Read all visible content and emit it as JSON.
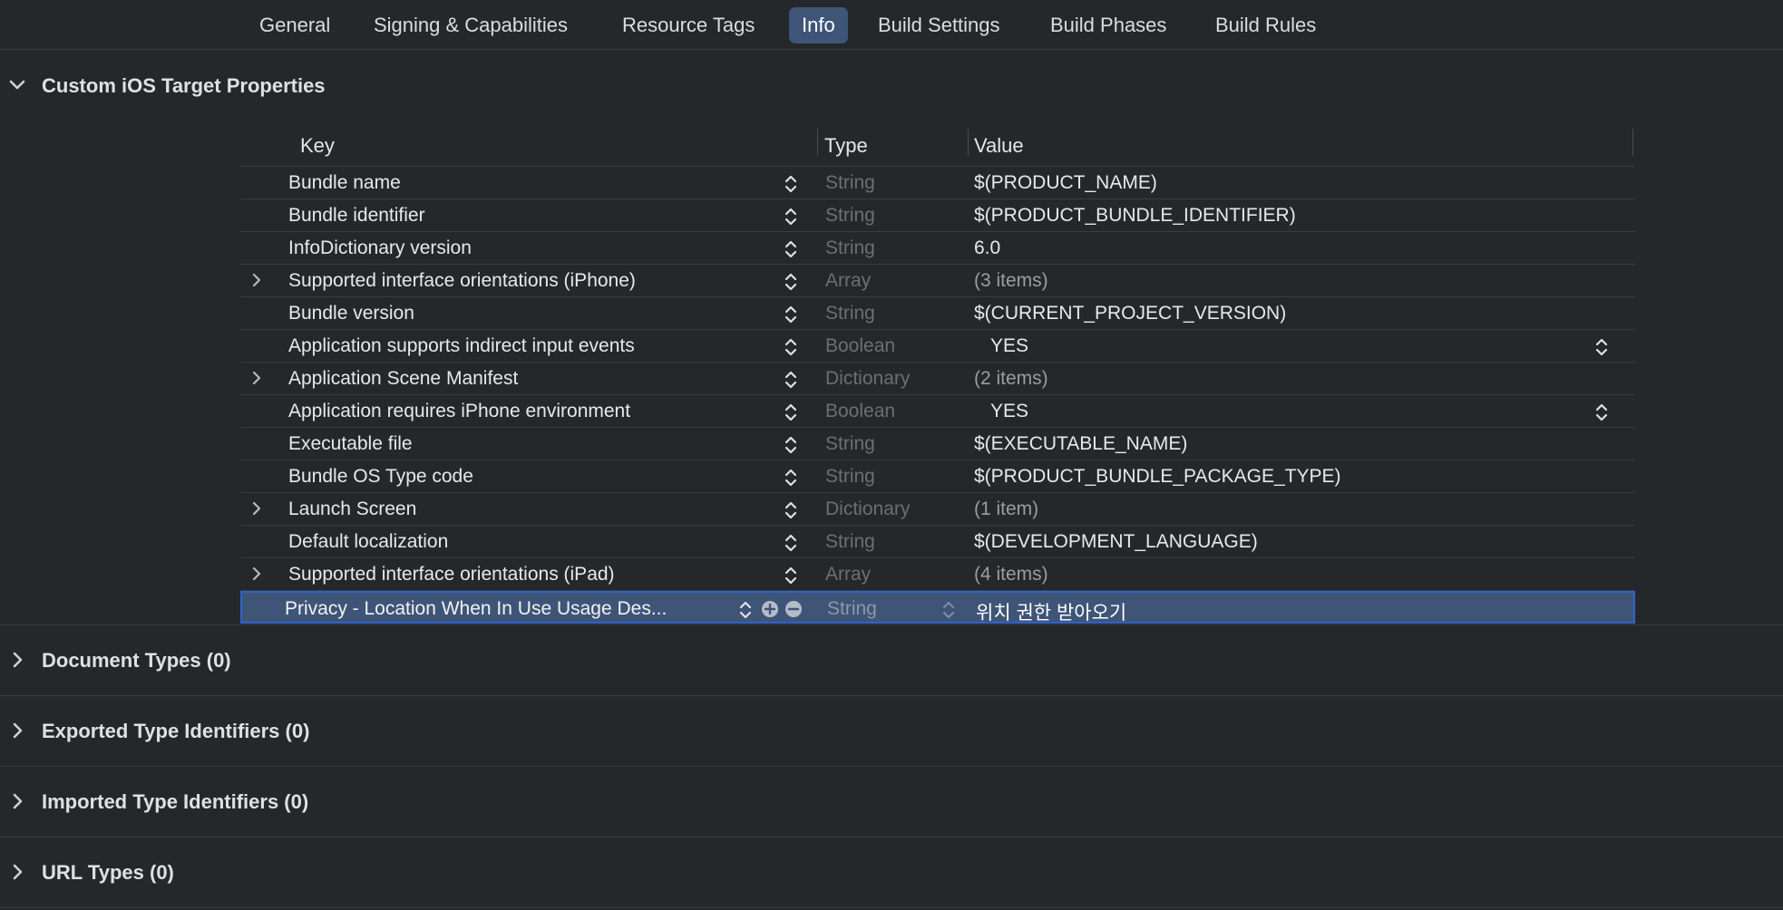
{
  "tabs": [
    {
      "label": "General",
      "active": false
    },
    {
      "label": "Signing & Capabilities",
      "active": false
    },
    {
      "label": "Resource Tags",
      "active": false
    },
    {
      "label": "Info",
      "active": true
    },
    {
      "label": "Build Settings",
      "active": false
    },
    {
      "label": "Build Phases",
      "active": false
    },
    {
      "label": "Build Rules",
      "active": false
    }
  ],
  "sections": {
    "custom": "Custom iOS Target Properties",
    "document": "Document Types (0)",
    "exported": "Exported Type Identifiers (0)",
    "imported": "Imported Type Identifiers (0)",
    "url": "URL Types (0)"
  },
  "table": {
    "headers": {
      "key": "Key",
      "type": "Type",
      "value": "Value"
    },
    "rows": [
      {
        "key": "Bundle name",
        "type": "String",
        "value": "$(PRODUCT_NAME)"
      },
      {
        "key": "Bundle identifier",
        "type": "String",
        "value": "$(PRODUCT_BUNDLE_IDENTIFIER)"
      },
      {
        "key": "InfoDictionary version",
        "type": "String",
        "value": "6.0"
      },
      {
        "key": "Supported interface orientations (iPhone)",
        "type": "Array",
        "value": "(3 items)"
      },
      {
        "key": "Bundle version",
        "type": "String",
        "value": "$(CURRENT_PROJECT_VERSION)"
      },
      {
        "key": "Application supports indirect input events",
        "type": "Boolean",
        "value": "YES"
      },
      {
        "key": "Application Scene Manifest",
        "type": "Dictionary",
        "value": "(2 items)"
      },
      {
        "key": "Application requires iPhone environment",
        "type": "Boolean",
        "value": "YES"
      },
      {
        "key": "Executable file",
        "type": "String",
        "value": "$(EXECUTABLE_NAME)"
      },
      {
        "key": "Bundle OS Type code",
        "type": "String",
        "value": "$(PRODUCT_BUNDLE_PACKAGE_TYPE)"
      },
      {
        "key": "Launch Screen",
        "type": "Dictionary",
        "value": "(1 item)"
      },
      {
        "key": "Default localization",
        "type": "String",
        "value": "$(DEVELOPMENT_LANGUAGE)"
      },
      {
        "key": "Supported interface orientations (iPad)",
        "type": "Array",
        "value": "(4 items)"
      },
      {
        "key": "Privacy - Location When In Use Usage Des...",
        "type": "String",
        "value": "위치 권한 받아오기"
      }
    ]
  },
  "colors": {
    "background": "#25282a",
    "selection": "#3e5578",
    "selection_border": "#2f63c9",
    "divider": "#3a3d40"
  }
}
